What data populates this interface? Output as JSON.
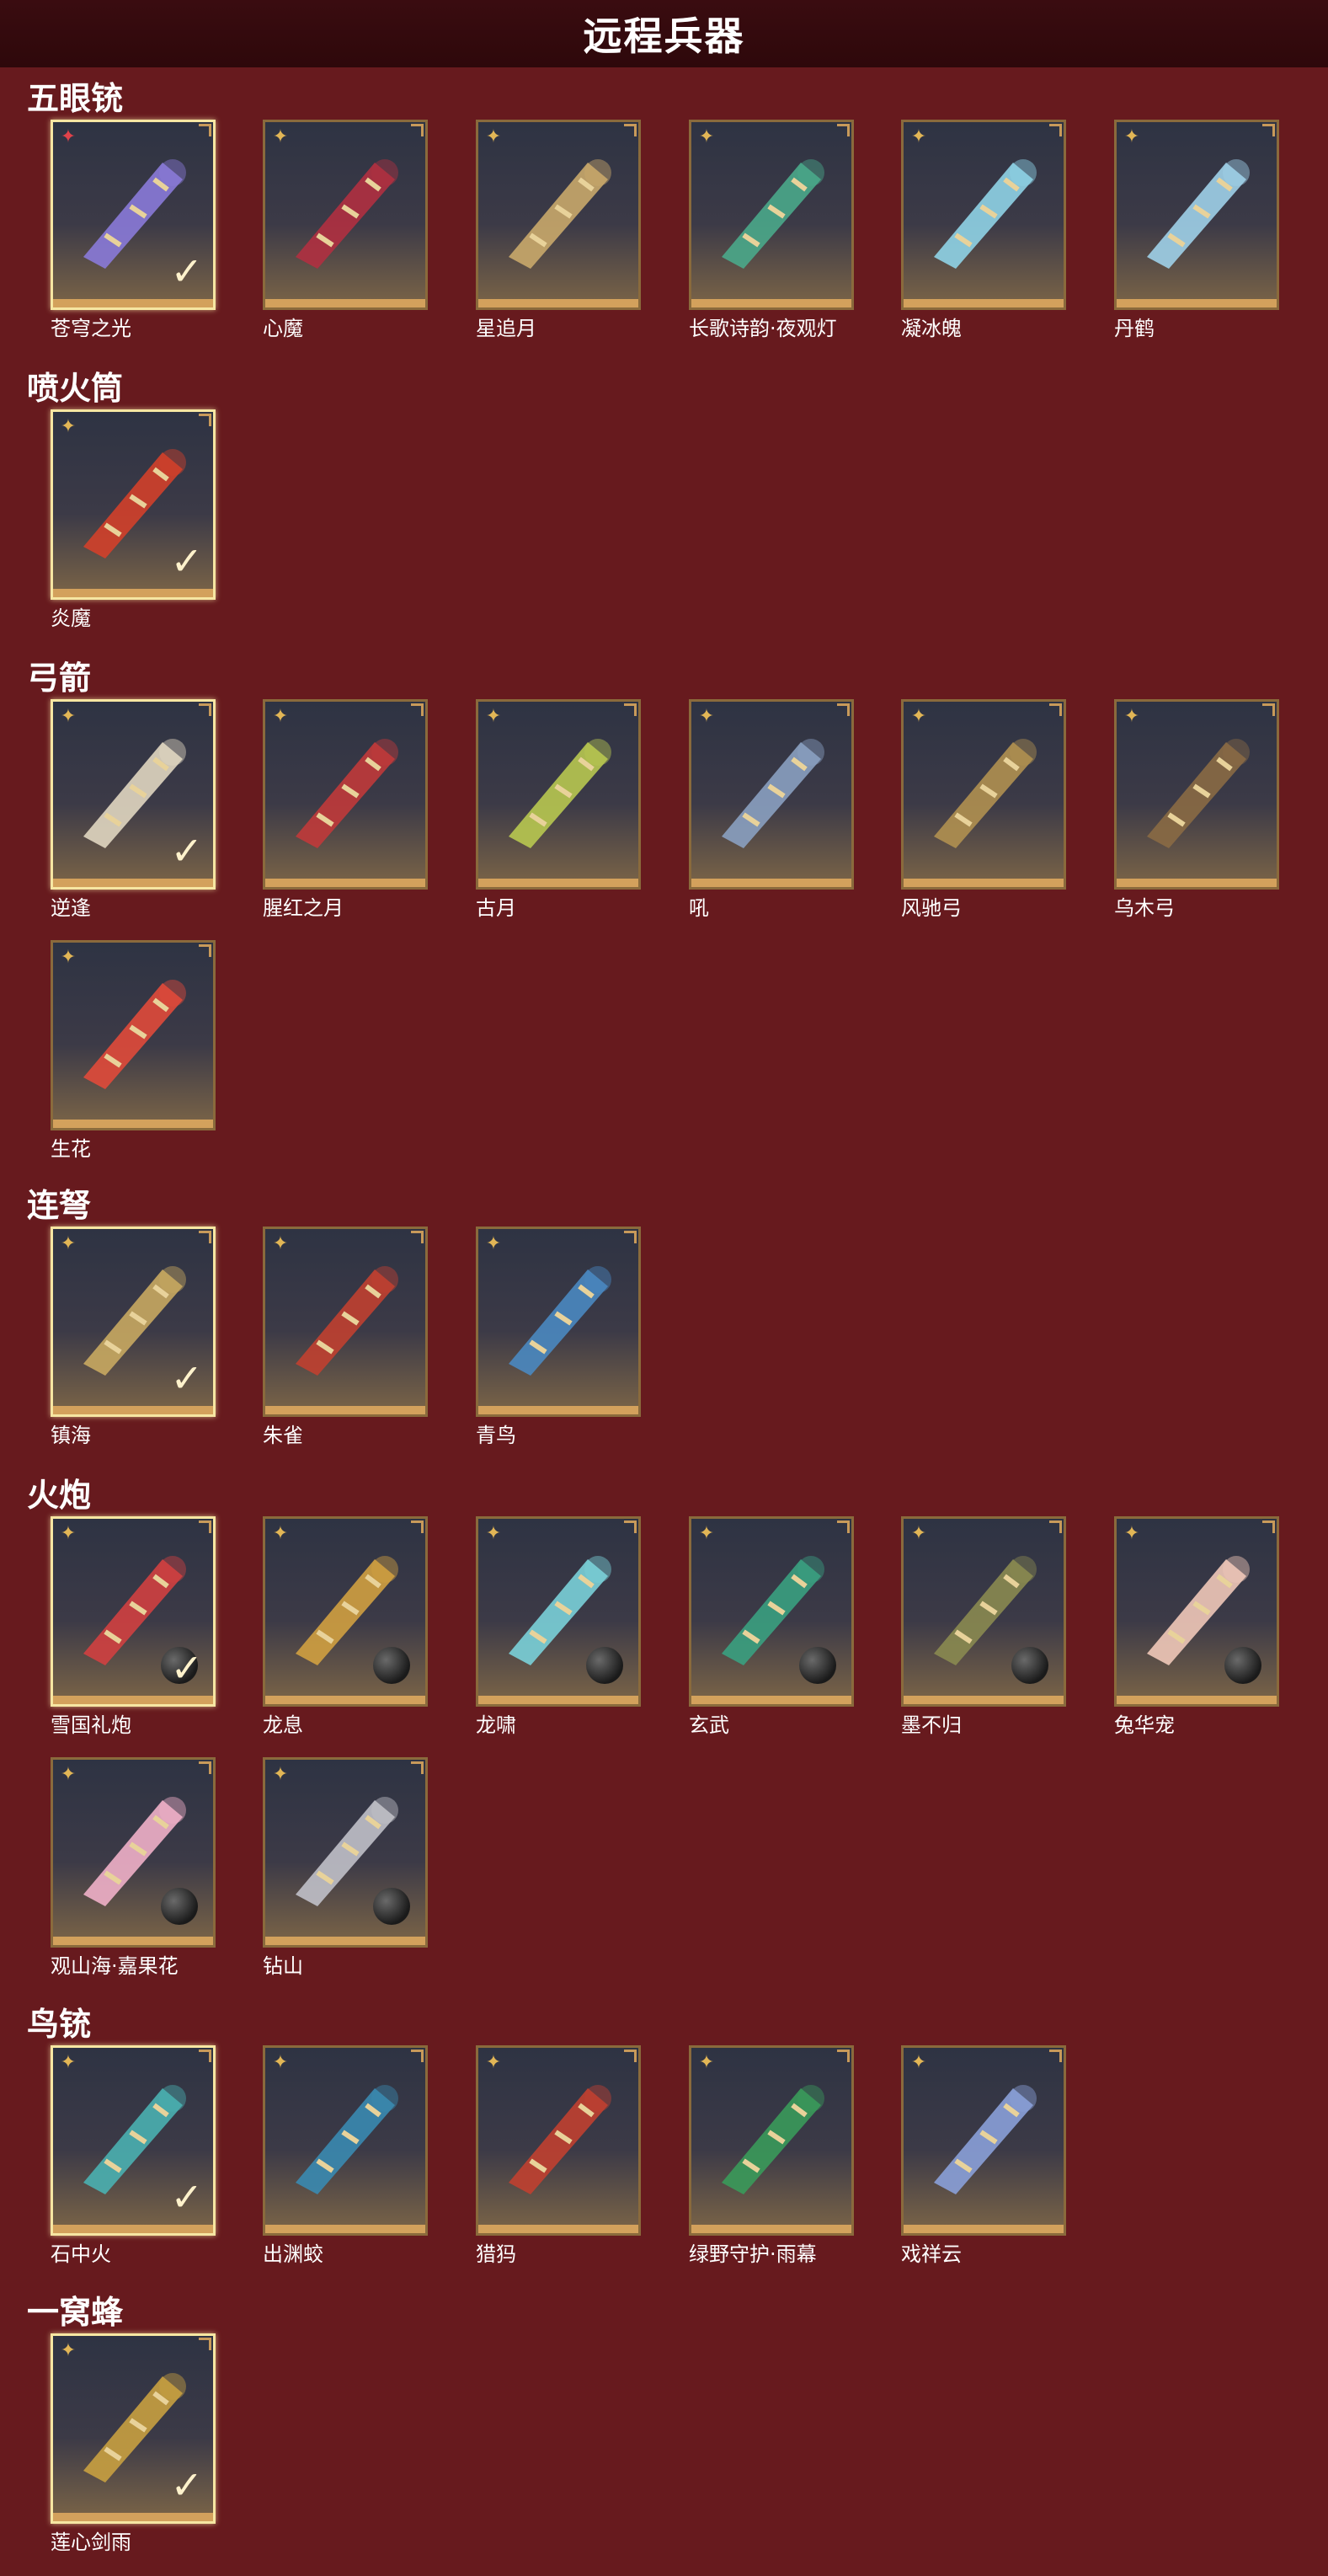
{
  "title": "远程兵器",
  "categories": [
    {
      "name": "五眼铳",
      "items": [
        {
          "name": "苍穹之光",
          "selected": true,
          "badge": "pink",
          "color": "#8a7ad8"
        },
        {
          "name": "心魔",
          "color": "#b03040"
        },
        {
          "name": "星追月",
          "color": "#c9a86a"
        },
        {
          "name": "长歌诗韵·夜观灯",
          "color": "#4aa88a"
        },
        {
          "name": "凝冰魄",
          "color": "#8fd3e6"
        },
        {
          "name": "丹鹤",
          "color": "#9fd0e8"
        }
      ]
    },
    {
      "name": "喷火筒",
      "items": [
        {
          "name": "炎魔",
          "selected": true,
          "color": "#d2402a"
        }
      ]
    },
    {
      "name": "弓箭",
      "items": [
        {
          "name": "逆逢",
          "selected": true,
          "color": "#e0d6c0"
        },
        {
          "name": "腥红之月",
          "color": "#c03a3a"
        },
        {
          "name": "古月",
          "color": "#b8c850"
        },
        {
          "name": "吼",
          "color": "#8aa0c0"
        },
        {
          "name": "风驰弓",
          "color": "#b09050"
        },
        {
          "name": "乌木弓",
          "color": "#8a6a44"
        },
        {
          "name": "生花",
          "color": "#e04a3a"
        }
      ]
    },
    {
      "name": "连弩",
      "items": [
        {
          "name": "镇海",
          "selected": true,
          "color": "#c8a860"
        },
        {
          "name": "朱雀",
          "color": "#c04030"
        },
        {
          "name": "青鸟",
          "color": "#4a88c0"
        }
      ]
    },
    {
      "name": "火炮",
      "items": [
        {
          "name": "雪国礼炮",
          "selected": true,
          "ball": true,
          "color": "#d04040"
        },
        {
          "name": "龙息",
          "ball": true,
          "color": "#d0a040"
        },
        {
          "name": "龙啸",
          "ball": true,
          "color": "#7ad0d8"
        },
        {
          "name": "玄武",
          "ball": true,
          "color": "#3aa080"
        },
        {
          "name": "墨不归",
          "ball": true,
          "color": "#8a8a50"
        },
        {
          "name": "兔华宠",
          "ball": true,
          "color": "#f0c8b8"
        },
        {
          "name": "观山海·嘉果花",
          "ball": true,
          "color": "#f0b0c8"
        },
        {
          "name": "钻山",
          "ball": true,
          "color": "#c0c0c8"
        }
      ]
    },
    {
      "name": "鸟铳",
      "items": [
        {
          "name": "石中火",
          "selected": true,
          "color": "#4ab0b0"
        },
        {
          "name": "出渊蛟",
          "color": "#3a8ab0"
        },
        {
          "name": "猎犸",
          "color": "#c04030"
        },
        {
          "name": "绿野守护·雨幕",
          "color": "#3a9a5a"
        },
        {
          "name": "戏祥云",
          "color": "#8aa0d8"
        }
      ]
    },
    {
      "name": "一窝蜂",
      "items": [
        {
          "name": "莲心剑雨",
          "selected": true,
          "color": "#c8a040"
        }
      ]
    }
  ]
}
